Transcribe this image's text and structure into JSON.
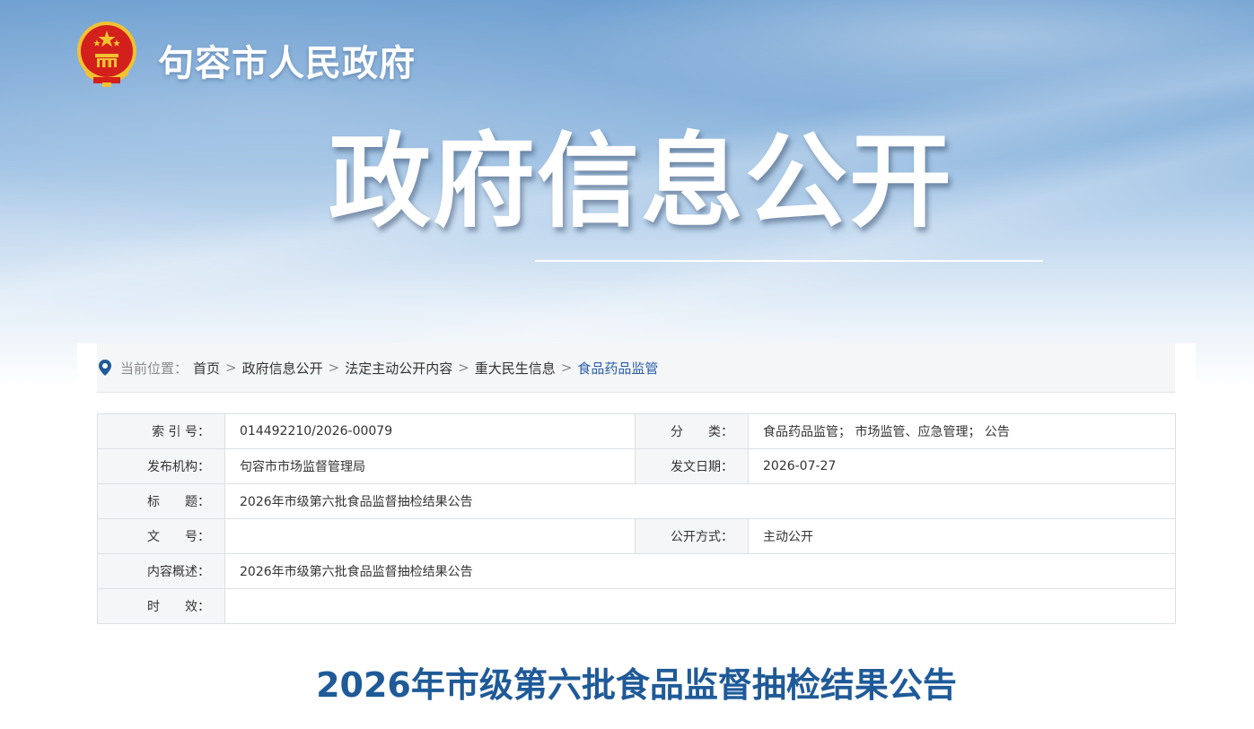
{
  "header": {
    "site_name": "句容市人民政府",
    "banner_title": "政府信息公开"
  },
  "breadcrumb": {
    "label": "当前位置：",
    "items": [
      "首页",
      "政府信息公开",
      "法定主动公开内容",
      "重大民生信息",
      "食品药品监管"
    ],
    "separator": ">"
  },
  "meta": {
    "index_no_label": "索 引 号：",
    "index_no": "014492210/2026-00079",
    "category_label": "分　　类：",
    "category": "食品药品监管； 市场监管、应急管理； 公告",
    "publisher_label": "发布机构：",
    "publisher": "句容市市场监督管理局",
    "date_label": "发文日期：",
    "date": "2026-07-27",
    "title_label": "标　　题：",
    "title": "2026年市级第六批食品监督抽检结果公告",
    "doc_no_label": "文　　号：",
    "doc_no": "",
    "open_mode_label": "公开方式：",
    "open_mode": "主动公开",
    "summary_label": "内容概述：",
    "summary": "2026年市级第六批食品监督抽检结果公告",
    "validity_label": "时　　效：",
    "validity": ""
  },
  "article": {
    "title": "2026年市级第六批食品监督抽检结果公告"
  },
  "colors": {
    "accent": "#2a5ea8",
    "article_title": "#1f5a98",
    "emblem_red": "#d3201c",
    "emblem_gold": "#f2c230"
  },
  "icons": {
    "emblem": "national-emblem",
    "location": "location-pin-icon"
  }
}
